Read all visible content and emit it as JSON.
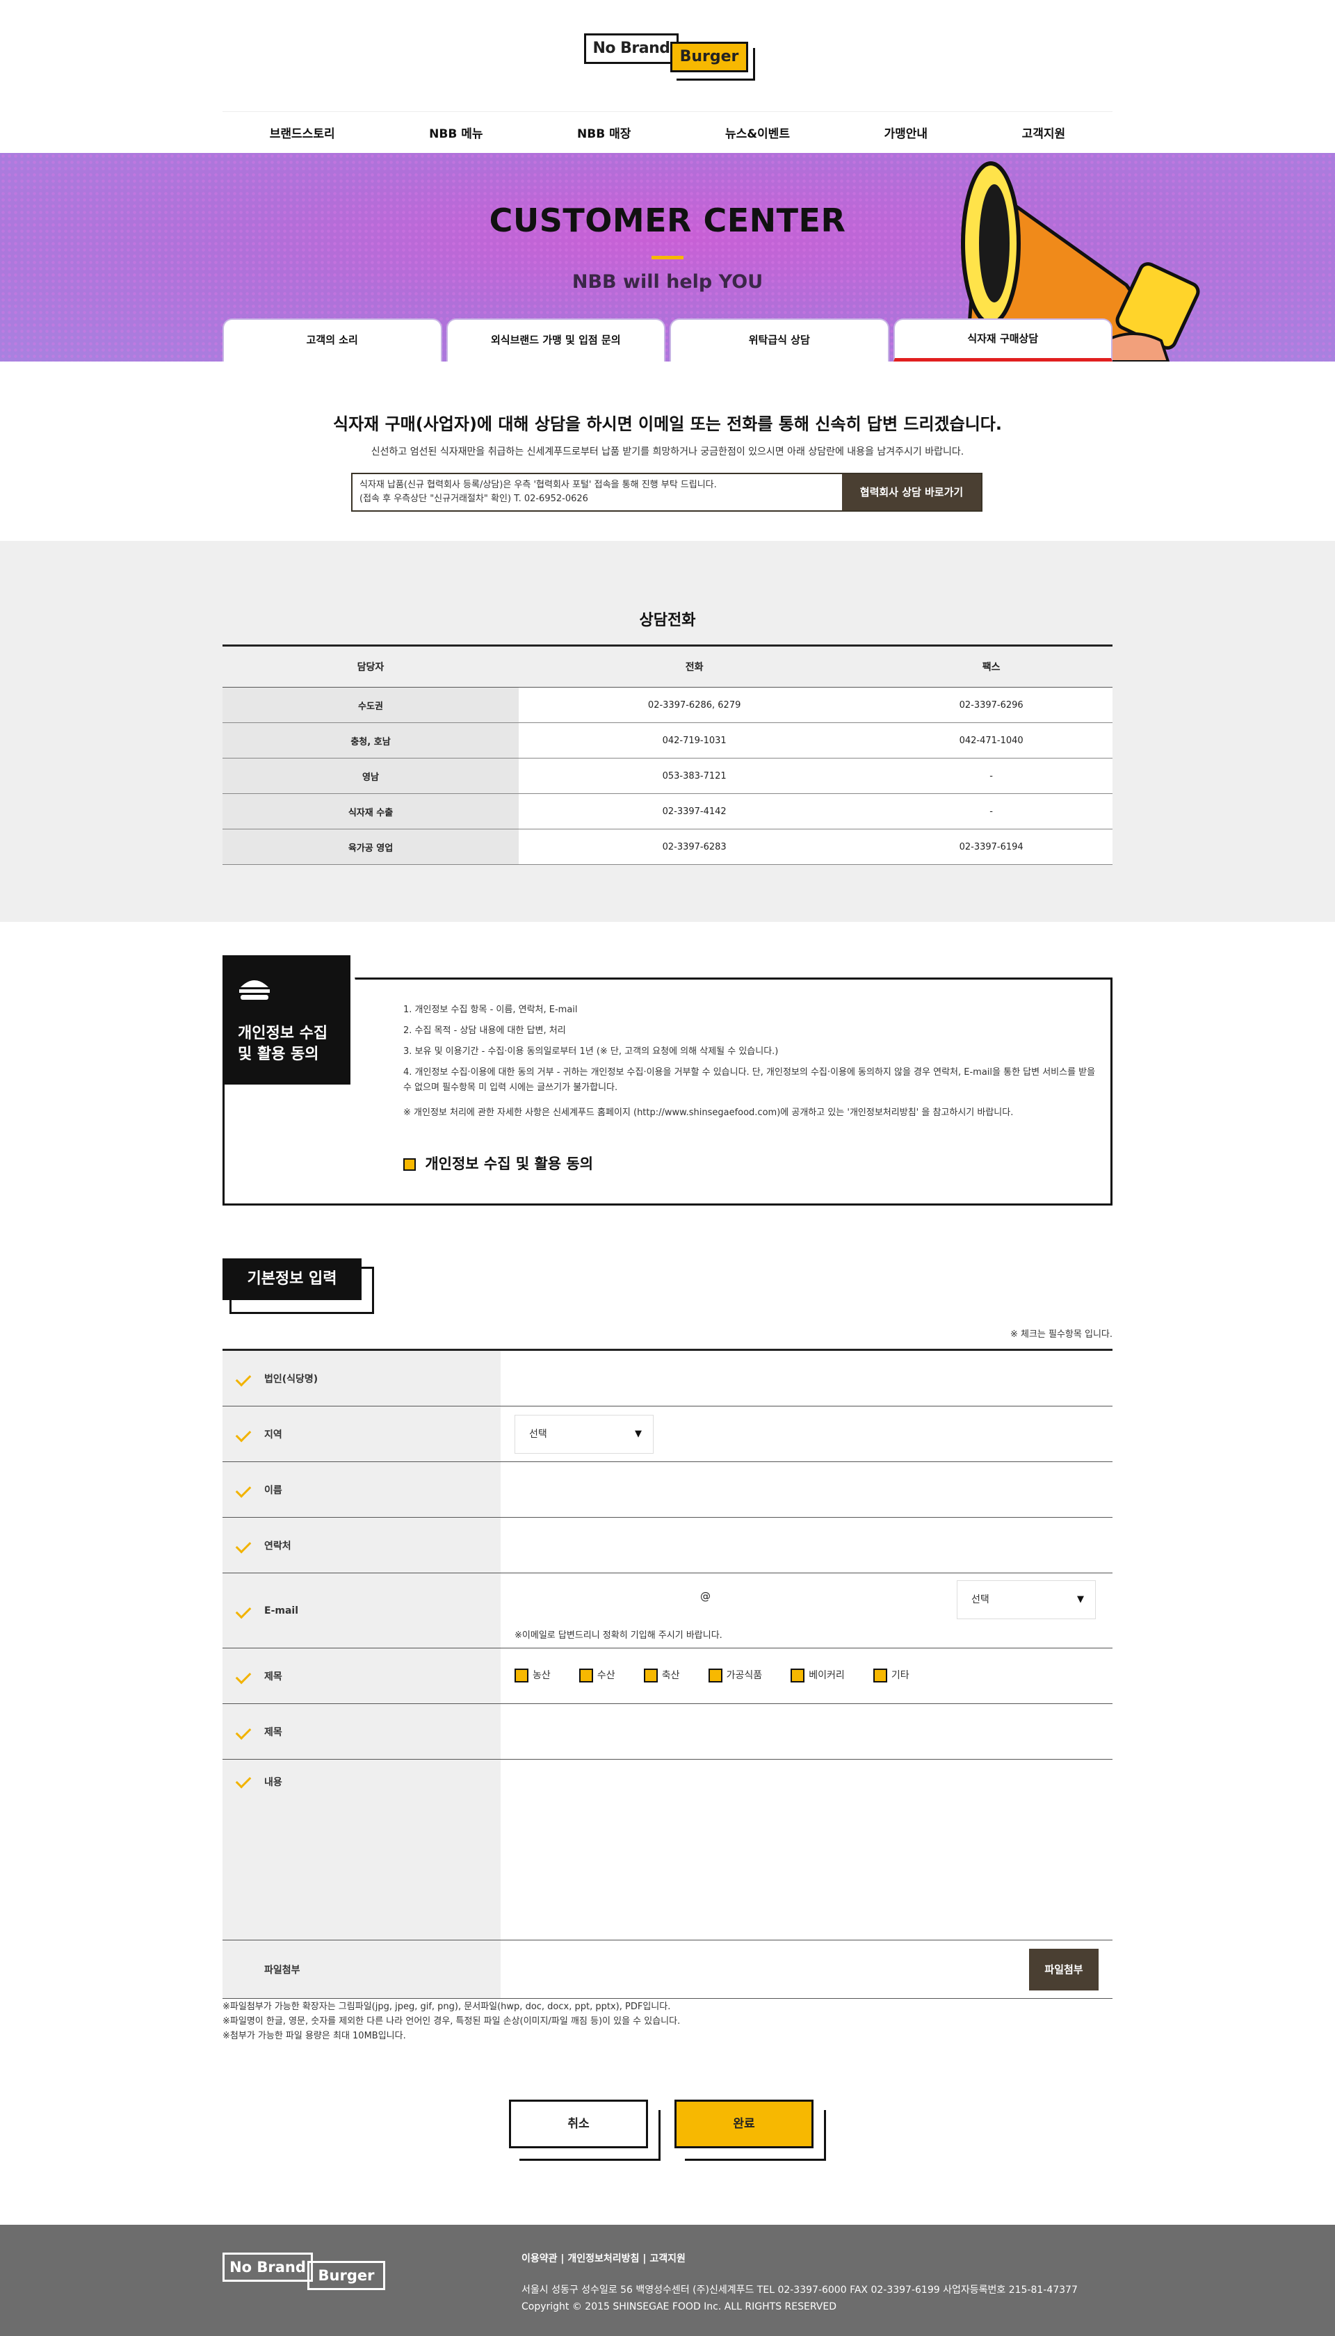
{
  "logo": {
    "part1": "No Brand",
    "part2": "Burger"
  },
  "gnb": [
    "브랜드스토리",
    "NBB 메뉴",
    "NBB 매장",
    "뉴스&이벤트",
    "가맹안내",
    "고객지원"
  ],
  "hero": {
    "title": "CUSTOMER CENTER",
    "subtitle": "NBB will help YOU"
  },
  "tabs": [
    "고객의 소리",
    "외식브랜드 가맹 및 입점 문의",
    "위탁급식 상담",
    "식자재 구매상담"
  ],
  "intro": {
    "heading": "식자재 구매(사업자)에 대해 상담을 하시면 이메일 또는 전화를 통해 신속히 답변 드리겠습니다.",
    "desc": "신선하고 엄선된 식자재만을 취급하는 신세계푸드로부터 납품 받기를 희망하거나 궁금한점이 있으시면 아래 상담란에 내용을 남겨주시기 바랍니다.",
    "notice_line1": "식자재 납품(신규 협력회사 등록/상담)은 우측 '협력회사 포털' 접속을 통해 진행 부탁 드립니다.",
    "notice_line2": "(접속 후 우측상단 \"신규거래절차\" 확인)  T. 02-6952-0626",
    "notice_button": "협력회사 상담 바로가기"
  },
  "phone": {
    "title": "상담전화",
    "headers": [
      "담당자",
      "전화",
      "팩스"
    ],
    "rows": [
      [
        "수도권",
        "02-3397-6286, 6279",
        "02-3397-6296"
      ],
      [
        "충청, 호남",
        "042-719-1031",
        "042-471-1040"
      ],
      [
        "영남",
        "053-383-7121",
        "-"
      ],
      [
        "식자재 수출",
        "02-3397-4142",
        "-"
      ],
      [
        "육가공 영업",
        "02-3397-6283",
        "02-3397-6194"
      ]
    ]
  },
  "privacy": {
    "title1": "개인정보 수집",
    "title2": "및 활용 동의",
    "items": [
      "1. 개인정보 수집 항목  - 이름, 연락처, E-mail",
      "2. 수집 목적  - 상담 내용에 대한 답변, 처리",
      "3. 보유 및 이용기간  - 수집·이용 동의일로부터 1년 (※ 단, 고객의 요청에 의해 삭제될 수 있습니다.)",
      "4. 개인정보 수집·이용에 대한 동의 거부  - 귀하는 개인정보 수집·이용을 거부할 수 있습니다. 단, 개인정보의 수집·이용에 동의하지 않을 경우 연락처, E-mail을 통한 답변 서비스를 받을 수 없으며 필수항목 미 입력 시에는 글쓰기가 불가합니다.",
      "※ 개인정보 처리에 관한 자세한 사항은 신세계푸드 홈페이지 (http://www.shinsegaefood.com)에 공개하고 있는 '개인정보처리방침' 을 참고하시기 바랍니다."
    ],
    "agree": "개인정보 수집 및 활용 동의"
  },
  "form": {
    "title": "기본정보 입력",
    "required_note": "※ 체크는 필수항목 입니다.",
    "labels": {
      "corp": "법인(식당명)",
      "region": "지역",
      "name": "이름",
      "contact": "연락처",
      "email": "E-mail",
      "subject_cat": "제목",
      "subject": "제목",
      "content": "내용",
      "file": "파일첨부"
    },
    "region_select": "선택",
    "email_at": "@",
    "email_select": "선택",
    "email_note": "※이메일로 답변드리니 정확히 기입해 주시기 바랍니다.",
    "categories": [
      "농산",
      "수산",
      "축산",
      "가공식품",
      "베이커리",
      "기타"
    ],
    "file_button": "파일첨부",
    "file_notes": [
      "※파일첨부가 가능한 확장자는 그림파일(jpg, jpeg, gif, png), 문서파일(hwp, doc, docx, ppt, pptx), PDF입니다.",
      "※파일명이 한글, 영문, 숫자를 제외한 다른 나라 언어인 경우, 특정된 파일 손상(이미지/파일 깨짐 등)이 있을 수 있습니다.",
      "※첨부가 가능한 파일 용량은 최대 10MB입니다."
    ],
    "cancel": "취소",
    "submit": "완료"
  },
  "footer": {
    "logo1": "No Brand",
    "logo2": "Burger",
    "links": [
      "이용약관",
      "개인정보처리방침",
      "고객지원"
    ],
    "sep": " | ",
    "address": "서울시 성동구 성수일로 56 백영성수센터 (주)신세계푸드  TEL 02-3397-6000  FAX 02-3397-6199  사업자등록번호 215-81-47377",
    "copyright": "Copyright © 2015 SHINSEGAE FOOD Inc. ALL RIGHTS RESERVED"
  },
  "colors": {
    "accent": "#f7b801",
    "dark_button": "#4a3f32",
    "hero": "#c95fd5",
    "active_tab": "#e11f1f",
    "footer": "#6d6d6d"
  }
}
